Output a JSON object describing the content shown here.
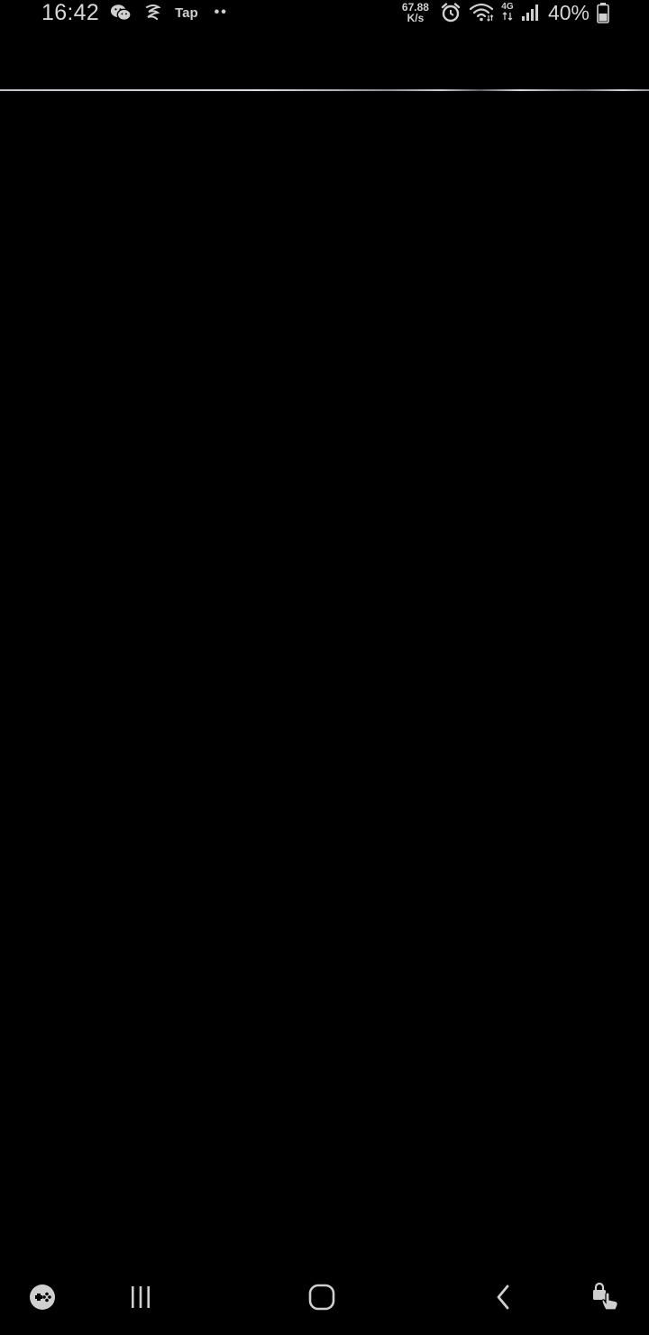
{
  "status_bar": {
    "time": "16:42",
    "notification_icons": [
      "wechat-icon",
      "weibo-icon"
    ],
    "tap_label": "Tap",
    "more_indicator": "••",
    "net_speed_value": "67.88",
    "net_speed_unit": "K/s",
    "network_type": "4G",
    "battery_percent": "40%"
  },
  "navigation_bar": {
    "buttons": [
      "game-tools-icon",
      "recent-apps-icon",
      "home-icon",
      "back-icon",
      "screen-pin-icon"
    ]
  },
  "colors": {
    "background": "#000000",
    "status_text": "#d6d6d6"
  }
}
